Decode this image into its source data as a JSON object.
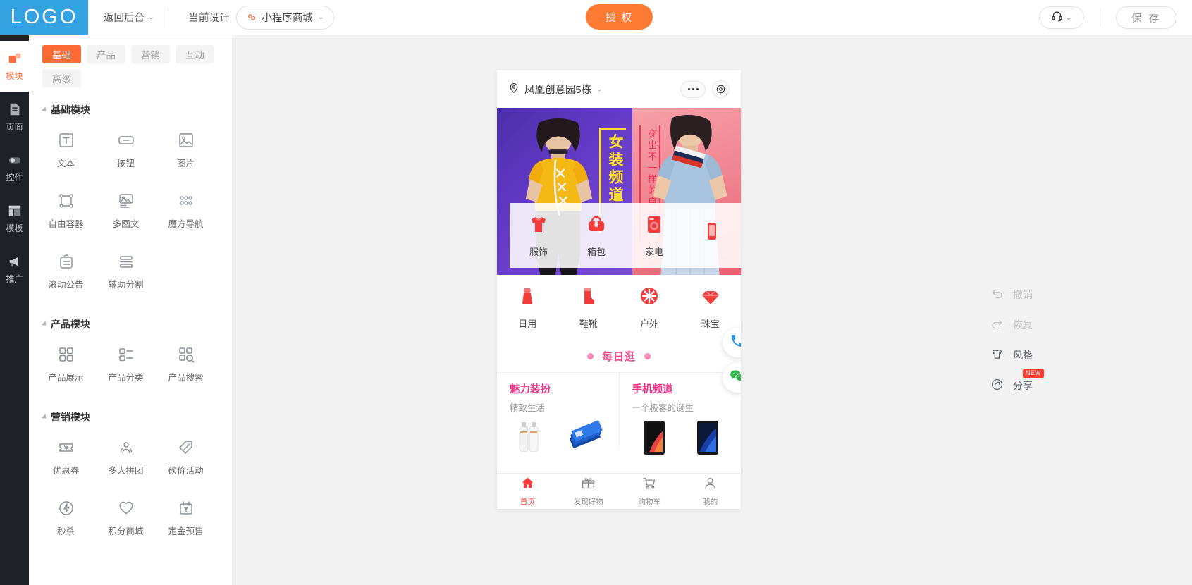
{
  "header": {
    "logo": "LOGO",
    "back_label": "返回后台",
    "current_design_label": "当前设计",
    "design_name": "小程序商城",
    "auth_button": "授 权",
    "save_button": "保 存"
  },
  "rail": {
    "items": [
      {
        "label": "模块",
        "icon": "blocks-icon",
        "active": true
      },
      {
        "label": "页面",
        "icon": "page-icon",
        "active": false
      },
      {
        "label": "控件",
        "icon": "toggle-icon",
        "active": false
      },
      {
        "label": "模板",
        "icon": "template-icon",
        "active": false
      },
      {
        "label": "推广",
        "icon": "megaphone-icon",
        "active": false
      }
    ]
  },
  "panel": {
    "tabs": [
      {
        "label": "基础",
        "active": true
      },
      {
        "label": "产品",
        "active": false
      },
      {
        "label": "营销",
        "active": false
      },
      {
        "label": "互动",
        "active": false
      },
      {
        "label": "高级",
        "active": false
      }
    ],
    "groups": [
      {
        "title": "基础模块",
        "items": [
          {
            "label": "文本",
            "icon": "text-icon"
          },
          {
            "label": "按钮",
            "icon": "button-icon"
          },
          {
            "label": "图片",
            "icon": "image-icon"
          },
          {
            "label": "自由容器",
            "icon": "free-container-icon"
          },
          {
            "label": "多图文",
            "icon": "multi-image-text-icon"
          },
          {
            "label": "魔方导航",
            "icon": "magic-nav-icon"
          },
          {
            "label": "滚动公告",
            "icon": "announcement-icon"
          },
          {
            "label": "辅助分割",
            "icon": "divider-icon"
          }
        ]
      },
      {
        "title": "产品模块",
        "items": [
          {
            "label": "产品展示",
            "icon": "product-grid-icon"
          },
          {
            "label": "产品分类",
            "icon": "product-category-icon"
          },
          {
            "label": "产品搜索",
            "icon": "product-search-icon"
          }
        ]
      },
      {
        "title": "营销模块",
        "items": [
          {
            "label": "优惠券",
            "icon": "coupon-icon"
          },
          {
            "label": "多人拼团",
            "icon": "group-buy-icon"
          },
          {
            "label": "砍价活动",
            "icon": "bargain-icon"
          },
          {
            "label": "秒杀",
            "icon": "flash-sale-icon"
          },
          {
            "label": "积分商城",
            "icon": "points-mall-icon"
          },
          {
            "label": "定金预售",
            "icon": "presale-icon"
          }
        ]
      }
    ]
  },
  "phone": {
    "location": "凤凰创意园5栋",
    "banner": {
      "title_yellow": "女装频道",
      "title_red": "穿出不一样的自己"
    },
    "categories_row1": [
      {
        "label": "服饰",
        "icon": "clothes-icon"
      },
      {
        "label": "箱包",
        "icon": "bag-icon"
      },
      {
        "label": "家电",
        "icon": "appliance-icon"
      },
      {
        "label": "",
        "icon": "phone-icon"
      }
    ],
    "categories_row2": [
      {
        "label": "日用",
        "icon": "daily-icon"
      },
      {
        "label": "鞋靴",
        "icon": "boots-icon"
      },
      {
        "label": "户外",
        "icon": "outdoor-icon"
      },
      {
        "label": "珠宝",
        "icon": "jewelry-icon"
      }
    ],
    "daily_title": "每日逛",
    "columns": [
      {
        "title": "魅力装扮",
        "subtitle": "精致生活"
      },
      {
        "title": "手机频道",
        "subtitle": "一个极客的诞生"
      }
    ],
    "tabbar": [
      {
        "label": "首页",
        "icon": "home-icon",
        "active": true
      },
      {
        "label": "发现好物",
        "icon": "gift-icon",
        "active": false
      },
      {
        "label": "购物车",
        "icon": "cart-icon",
        "active": false
      },
      {
        "label": "我的",
        "icon": "user-icon",
        "active": false
      }
    ],
    "fabs": [
      {
        "name": "call-fab",
        "icon": "phone-call-icon"
      },
      {
        "name": "wechat-fab",
        "icon": "wechat-icon"
      }
    ]
  },
  "tools": [
    {
      "label": "撤销",
      "icon": "undo-icon",
      "disabled": true,
      "badge": ""
    },
    {
      "label": "恢复",
      "icon": "redo-icon",
      "disabled": true,
      "badge": ""
    },
    {
      "label": "风格",
      "icon": "shirt-icon",
      "disabled": false,
      "badge": ""
    },
    {
      "label": "分享",
      "icon": "share-icon",
      "disabled": false,
      "badge": "NEW"
    }
  ],
  "colors": {
    "accent_orange": "#fd6a35",
    "logo_blue": "#32a2e0",
    "rail_dark": "#1e2228",
    "pink": "#ef2f84",
    "red": "#fb3b3b"
  }
}
